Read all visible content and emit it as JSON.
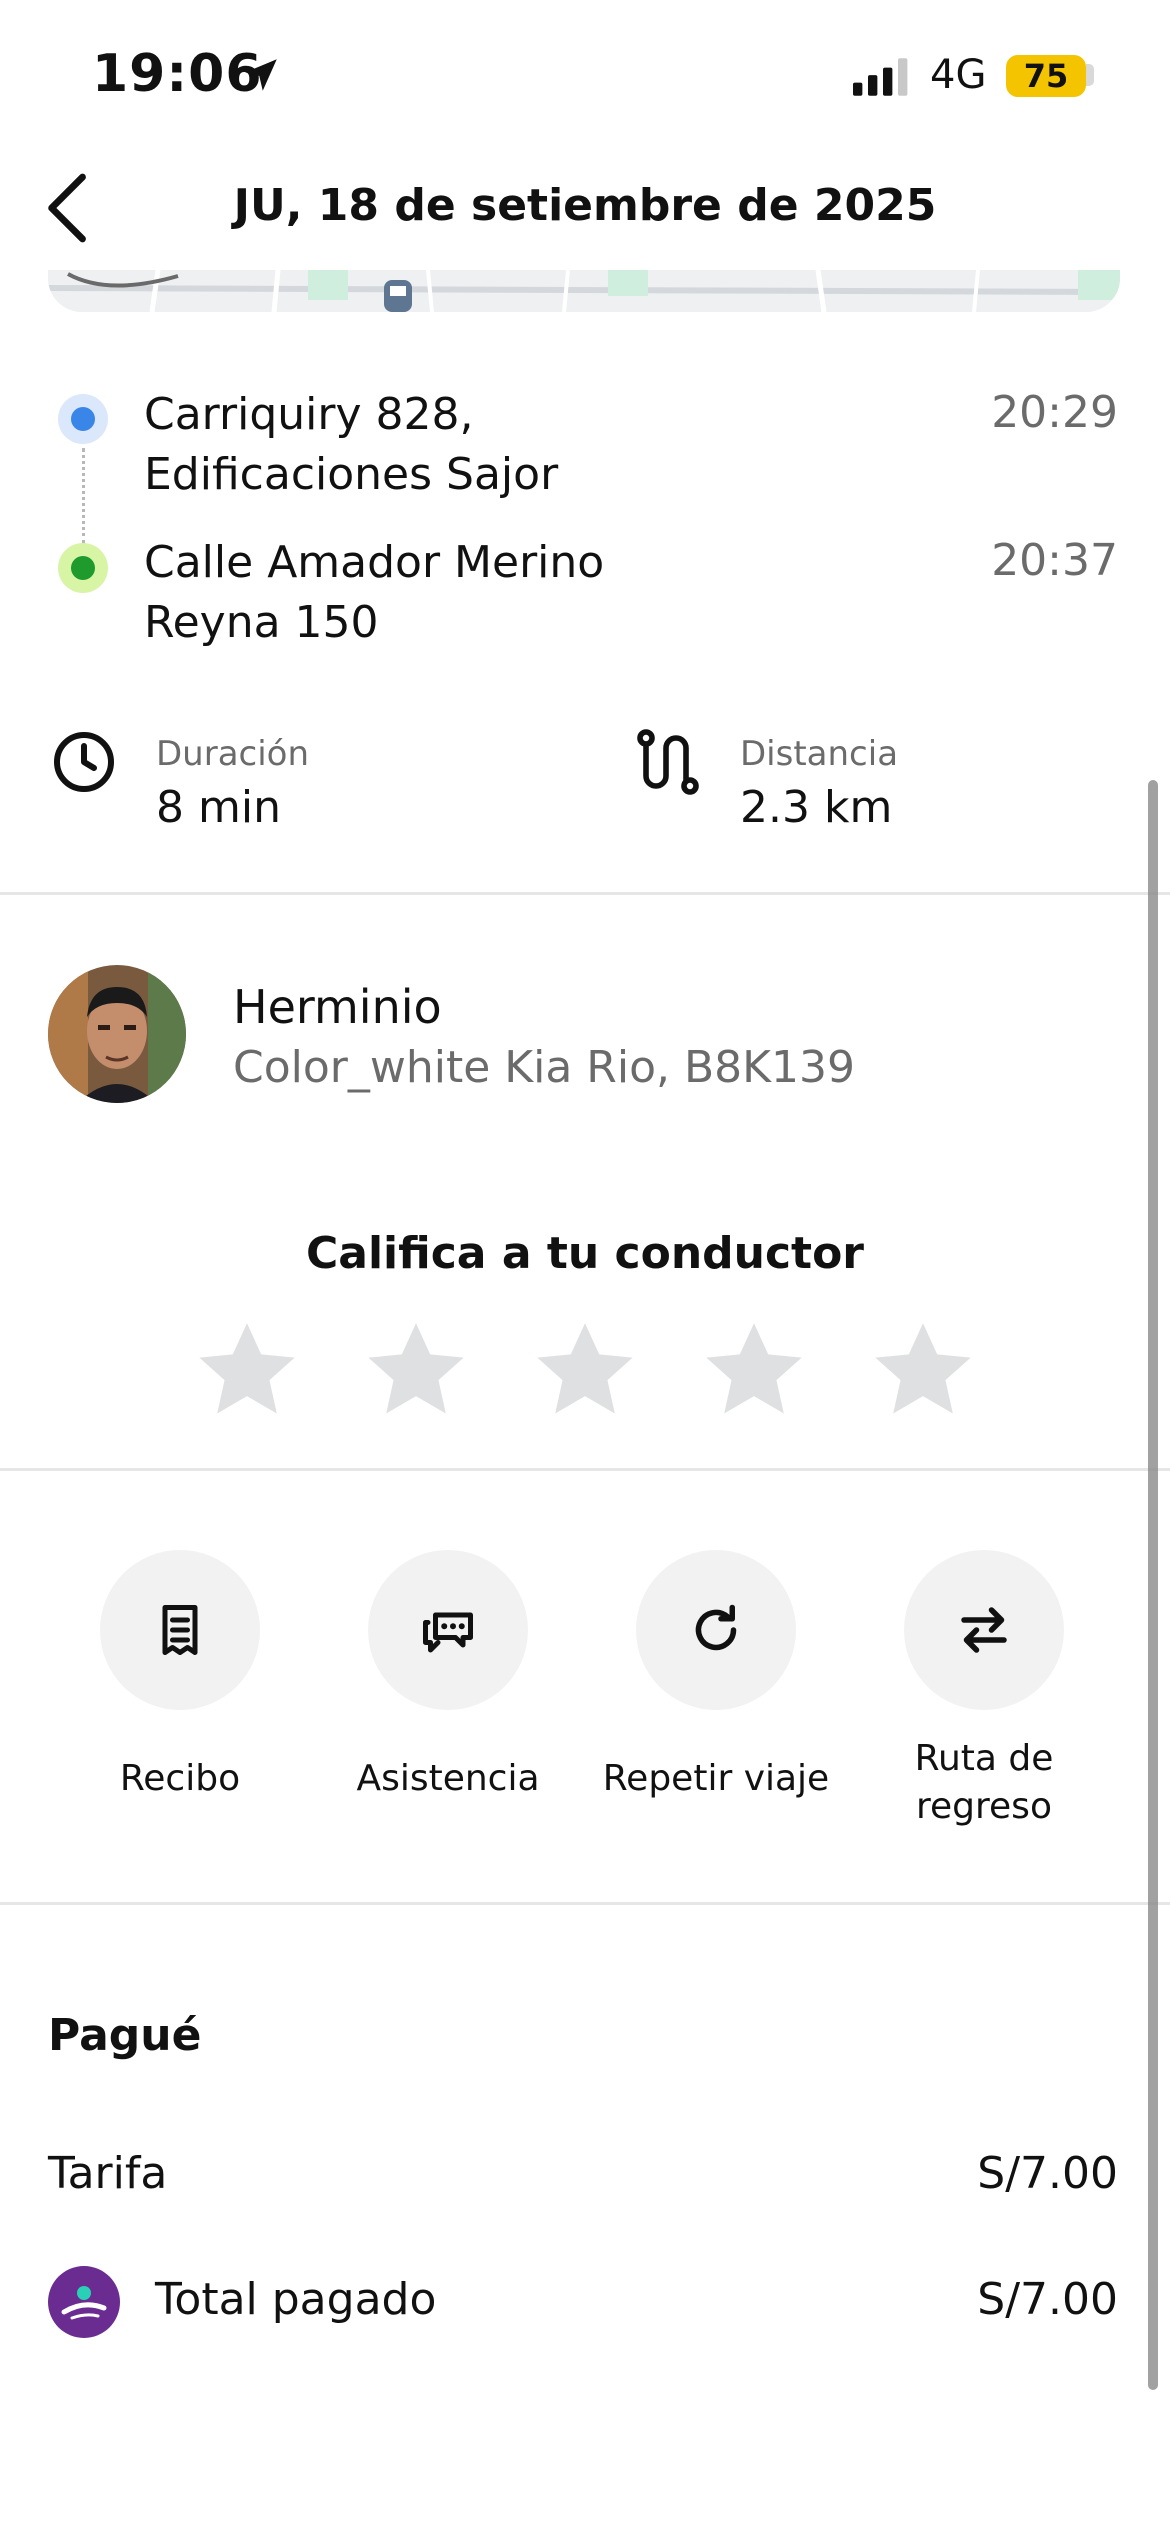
{
  "status_bar": {
    "time": "19:06",
    "network": "4G",
    "battery": "75"
  },
  "header": {
    "title": "JU, 18 de setiembre de 2025"
  },
  "route": {
    "pickup": {
      "address_line1": "Carriquiry 828,",
      "address_line2": "Edificaciones Sajor",
      "time": "20:29"
    },
    "dropoff": {
      "address_line1": "Calle Amador Merino",
      "address_line2": "Reyna 150",
      "time": "20:37"
    }
  },
  "stats": {
    "duration_label": "Duración",
    "duration_value": "8 min",
    "distance_label": "Distancia",
    "distance_value": "2.3 km"
  },
  "driver": {
    "name": "Herminio",
    "car": "Color_white Kia Rio, B8K139"
  },
  "rating": {
    "title": "Califica a tu conductor",
    "stars_total": 5,
    "stars_selected": 0
  },
  "actions": [
    {
      "label": "Recibo",
      "icon": "receipt-icon"
    },
    {
      "label": "Asistencia",
      "icon": "chat-support-icon"
    },
    {
      "label": "Repetir viaje",
      "icon": "repeat-icon"
    },
    {
      "label_line1": "Ruta de",
      "label_line2": "regreso",
      "icon": "swap-arrows-icon"
    }
  ],
  "payment": {
    "title": "Pagué",
    "fare_label": "Tarifa",
    "fare_value": "S/7.00",
    "total_label": "Total pagado",
    "total_value": "S/7.00",
    "method_icon": "yape-icon"
  },
  "colors": {
    "pickup_dot": "#3a86e8",
    "dropoff_dot": "#1f9a2d",
    "battery": "#f4c400",
    "yape": "#6a2c91"
  }
}
